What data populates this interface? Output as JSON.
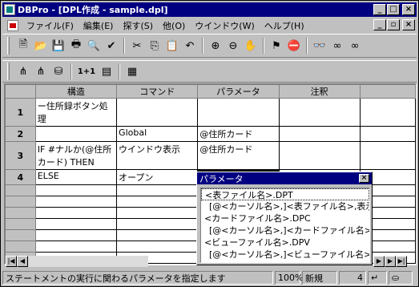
{
  "window": {
    "title": "DBPro - [DPL作成 - sample.dpl]"
  },
  "title_buttons": {
    "minimize": "_",
    "maximize": "□",
    "close": "×"
  },
  "menu": [
    "ファイル(F)",
    "編集(E)",
    "探す(S)",
    "他(O)",
    "ウインドウ(W)",
    "ヘルプ(H)"
  ],
  "menu_buttons": {
    "minimize": "_",
    "restore": "▫",
    "close": "×"
  },
  "toolbar1": [
    {
      "name": "new-icon",
      "glyph": "🗎"
    },
    {
      "name": "open-icon",
      "glyph": "📂"
    },
    {
      "name": "save-icon",
      "glyph": "💾"
    },
    {
      "name": "print-icon",
      "glyph": "🖶"
    },
    {
      "name": "preview-icon",
      "glyph": "🔍"
    },
    {
      "name": "check-icon",
      "glyph": "✔"
    },
    {
      "name": "cut-icon",
      "glyph": "✂"
    },
    {
      "name": "copy-icon",
      "glyph": "⎘"
    },
    {
      "name": "paste-icon",
      "glyph": "📋"
    },
    {
      "name": "undo-icon",
      "glyph": "↶"
    },
    {
      "name": "zoom-in-icon",
      "glyph": "⊕"
    },
    {
      "name": "zoom-out-icon",
      "glyph": "⊖"
    },
    {
      "name": "hand-icon",
      "glyph": "✋"
    },
    {
      "name": "flag-icon",
      "glyph": "⚑"
    },
    {
      "name": "stop-icon",
      "glyph": "⛔"
    },
    {
      "name": "binoculars-icon",
      "glyph": "👓"
    },
    {
      "name": "find-next-icon",
      "glyph": "∞"
    },
    {
      "name": "find-prev-icon",
      "glyph": "∞"
    }
  ],
  "toolbar2": [
    {
      "name": "tree-icon",
      "glyph": "⋔"
    },
    {
      "name": "tree2-icon",
      "glyph": "⋔"
    },
    {
      "name": "db-icon",
      "glyph": "⛁"
    },
    {
      "name": "onetoone-icon",
      "glyph": "1+1"
    },
    {
      "name": "doc-list-icon",
      "glyph": "▤"
    },
    {
      "name": "grid-icon",
      "glyph": "▦"
    }
  ],
  "grid": {
    "headers": [
      "構造",
      "コマンド",
      "パラメータ",
      "注釈"
    ],
    "rows": [
      {
        "num": "1",
        "cells": [
          "ー住所録ボタン処理",
          "",
          "",
          ""
        ]
      },
      {
        "num": "2",
        "cells": [
          "",
          "Global",
          "@住所カード",
          ""
        ]
      },
      {
        "num": "3",
        "cells": [
          "IF #ナルか(@住所カード) THEN",
          "ウインドウ表示",
          "@住所カード",
          ""
        ]
      },
      {
        "num": "4",
        "cells": [
          "ELSE",
          "オープン",
          "",
          ""
        ]
      }
    ]
  },
  "param_popup": {
    "title": "パラメータ",
    "close": "×",
    "items": [
      "<表ファイル名>.DPT",
      "[@<カーソル名>,]<表ファイル名>,表示順",
      "<カードファイル名>.DPC",
      "[@<カーソル名>,]<カードファイル名>,対象",
      "<ビューファイル名>.DPV",
      "[@<カーソル名>,]<ビューファイル名>,表示"
    ]
  },
  "status": {
    "message": "ステートメントの実行に関わるパラメータを指定します",
    "zoom": "100%",
    "mode": "新規",
    "row": "4"
  }
}
